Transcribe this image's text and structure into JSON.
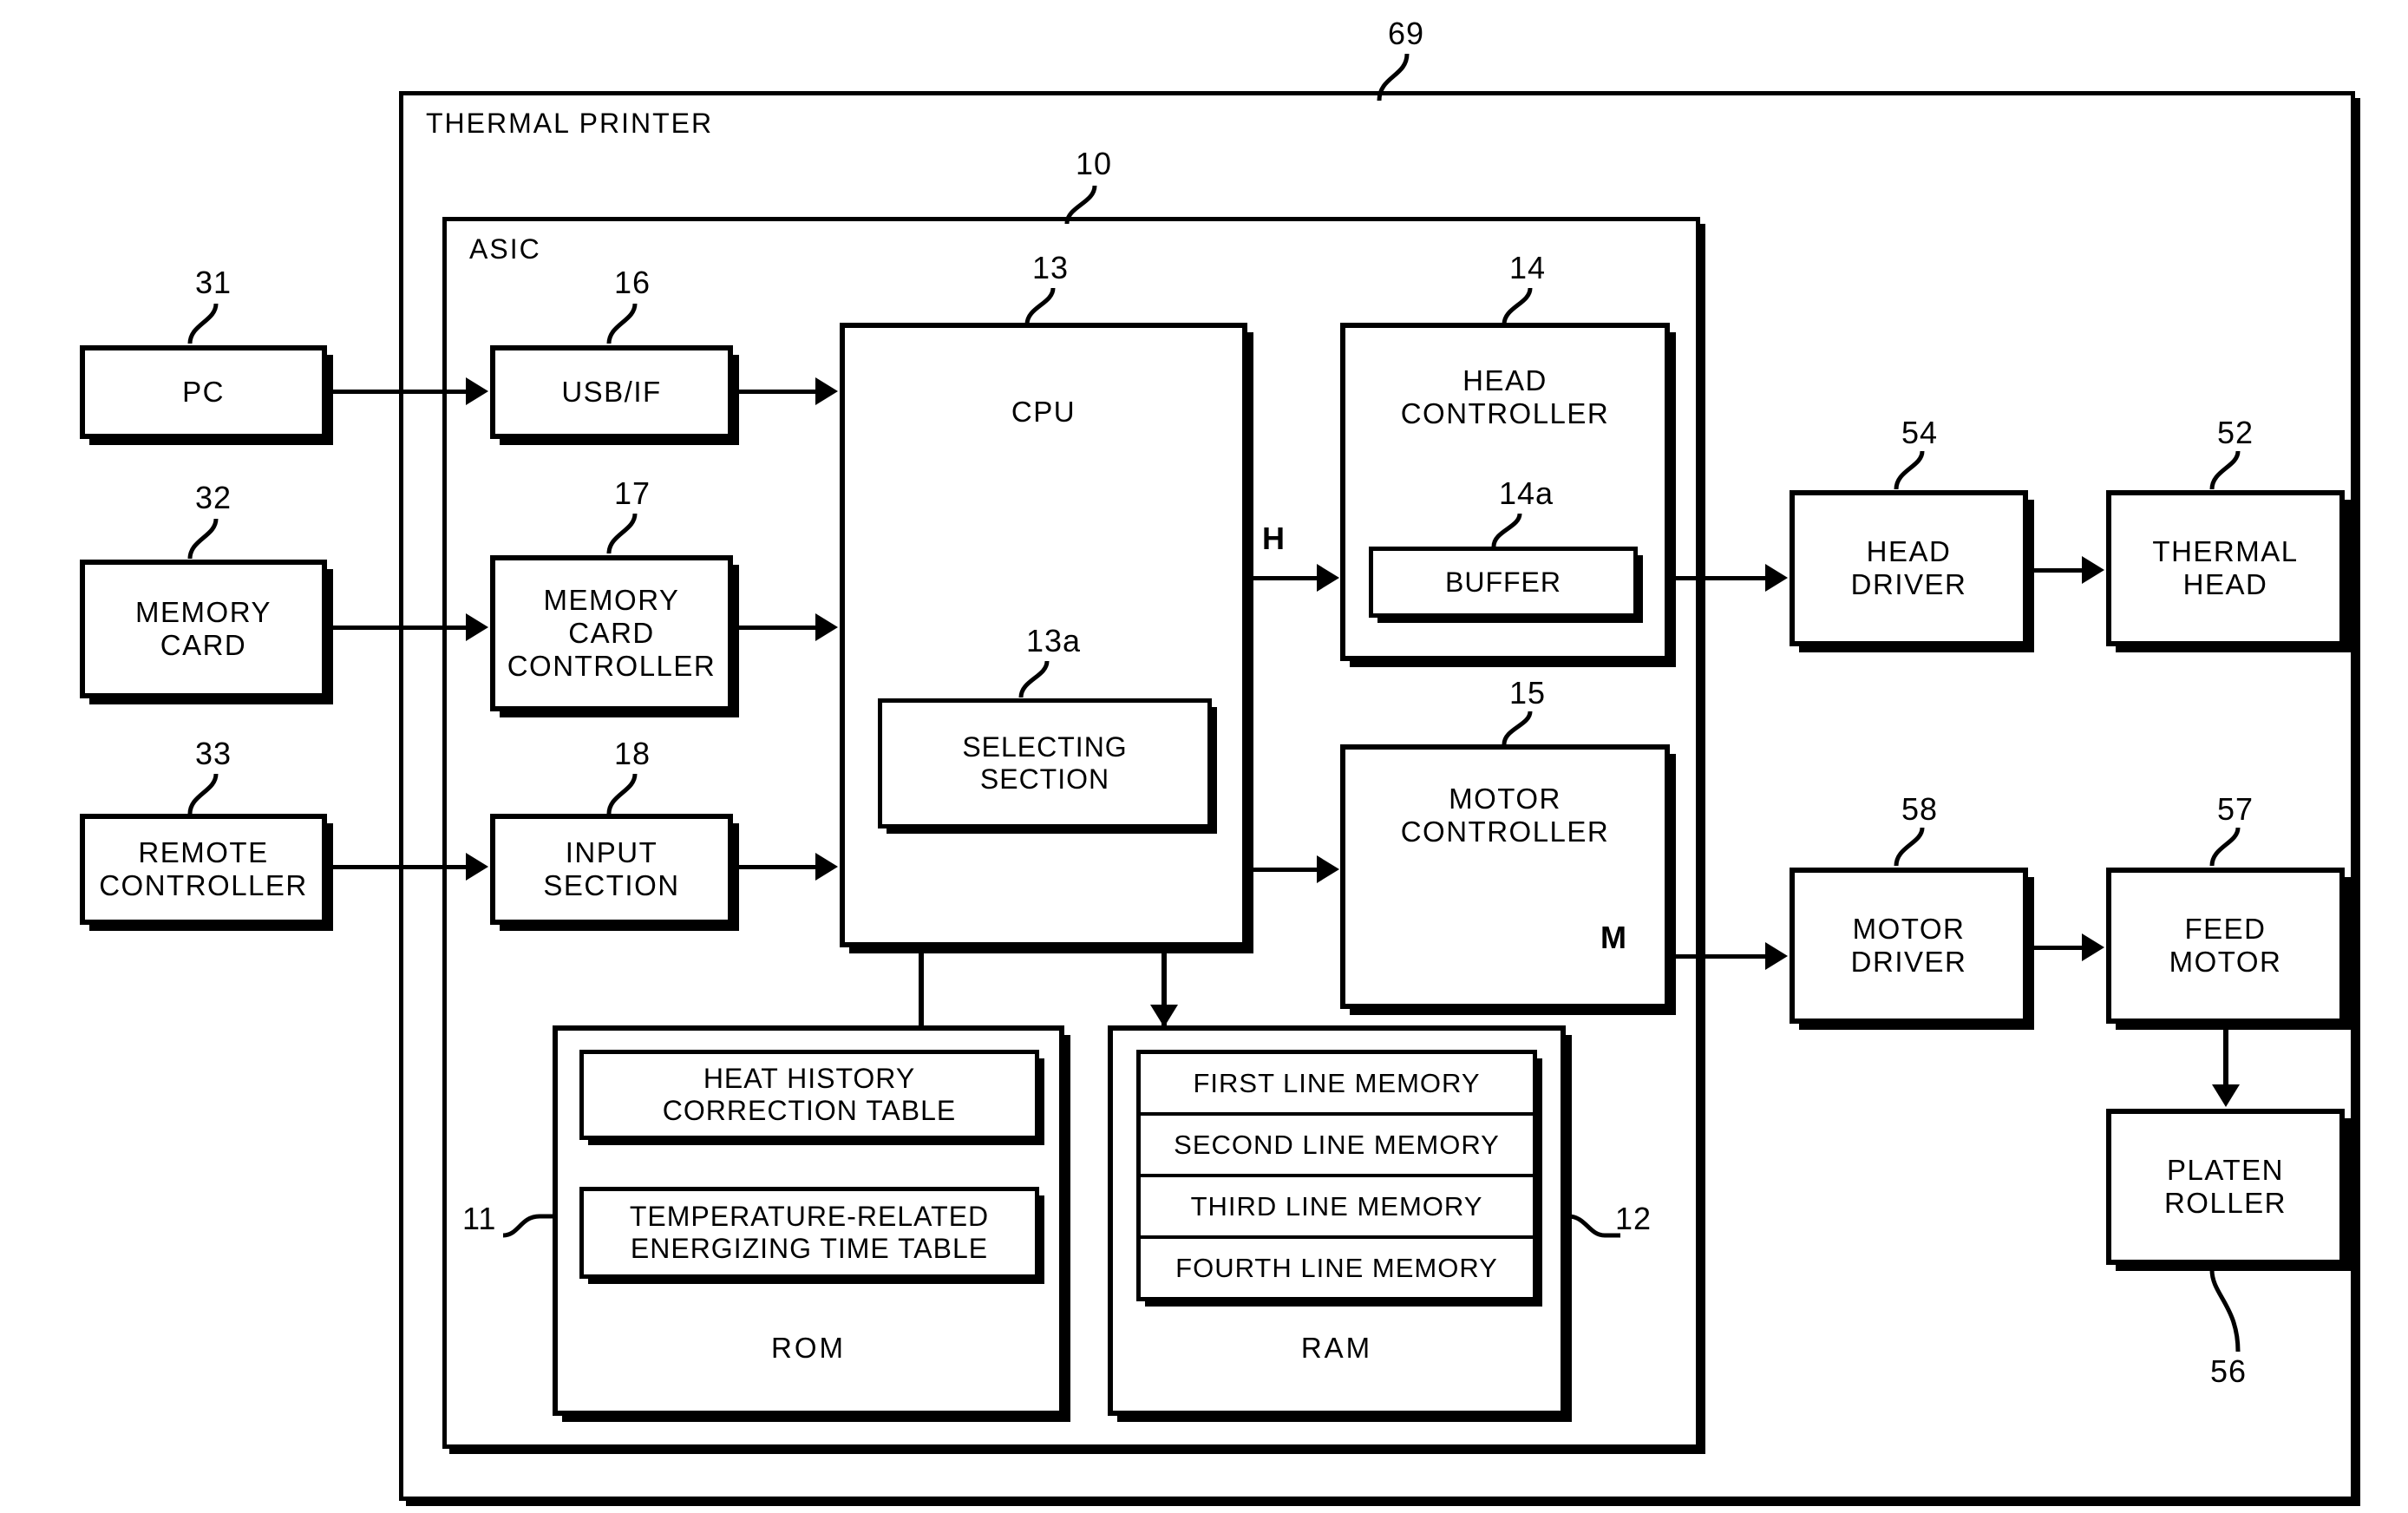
{
  "figure": {
    "outer_label": "THERMAL PRINTER",
    "outer_ref": "69",
    "asic_label": "ASIC",
    "asic_ref": "10"
  },
  "external_inputs": [
    {
      "label": "PC",
      "ref": "31"
    },
    {
      "label": "MEMORY\nCARD",
      "ref": "32"
    },
    {
      "label": "REMOTE\nCONTROLLER",
      "ref": "33"
    }
  ],
  "interfaces": [
    {
      "label": "USB/IF",
      "ref": "16"
    },
    {
      "label": "MEMORY\nCARD\nCONTROLLER",
      "ref": "17"
    },
    {
      "label": "INPUT\nSECTION",
      "ref": "18"
    }
  ],
  "cpu": {
    "label": "CPU",
    "ref": "13",
    "selecting_section": {
      "label": "SELECTING\nSECTION",
      "ref": "13a"
    }
  },
  "head_controller": {
    "label": "HEAD\nCONTROLLER",
    "ref": "14",
    "buffer": {
      "label": "BUFFER",
      "ref": "14a"
    }
  },
  "motor_controller": {
    "label": "MOTOR\nCONTROLLER",
    "ref": "15"
  },
  "signals": {
    "head": "H",
    "motor": "M"
  },
  "rom": {
    "label": "ROM",
    "ref": "11",
    "tables": [
      "HEAT HISTORY\nCORRECTION TABLE",
      "TEMPERATURE-RELATED\nENERGIZING TIME TABLE"
    ]
  },
  "ram": {
    "label": "RAM",
    "ref": "12",
    "memories": [
      "FIRST LINE MEMORY",
      "SECOND LINE MEMORY",
      "THIRD LINE MEMORY",
      "FOURTH LINE MEMORY"
    ]
  },
  "output_chain": [
    {
      "label": "HEAD\nDRIVER",
      "ref": "54"
    },
    {
      "label": "THERMAL\nHEAD",
      "ref": "52"
    },
    {
      "label": "MOTOR\nDRIVER",
      "ref": "58"
    },
    {
      "label": "FEED\nMOTOR",
      "ref": "57"
    },
    {
      "label": "PLATEN\nROLLER",
      "ref": "56"
    }
  ],
  "colors": {
    "ink": "#000000",
    "paper": "#ffffff"
  }
}
